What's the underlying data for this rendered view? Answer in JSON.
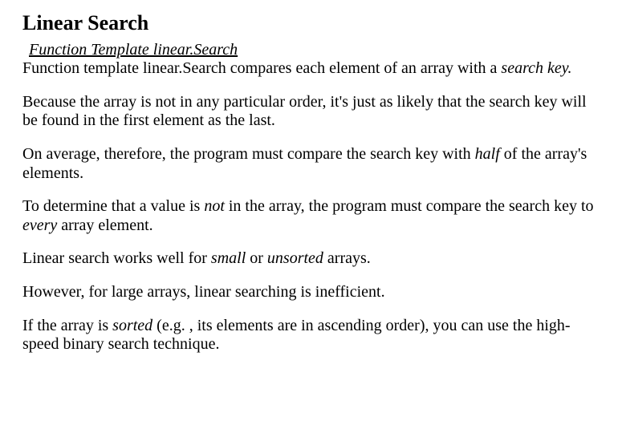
{
  "title": "Linear Search",
  "subheading": "Function Template linear.Search",
  "p1_a": "Function template linear.Search compares each element of an array with a ",
  "p1_b": "search key.",
  "p2": "Because the array is not in any particular order, it's just as likely that the search key will be found in the first element as the last.",
  "p3_a": "On average, therefore, the program must compare the search key with ",
  "p3_b": "half",
  "p3_c": " of the array's elements.",
  "p4_a": "To determine that a value is ",
  "p4_b": "not",
  "p4_c": " in the array, the program must compare the search key to ",
  "p4_d": "every",
  "p4_e": " array element.",
  "p5_a": "Linear search works well for ",
  "p5_b": "small",
  "p5_c": " or ",
  "p5_d": "unsorted",
  "p5_e": " arrays.",
  "p6": "However, for large arrays, linear searching is inefficient.",
  "p7_a": "If the array is ",
  "p7_b": "sorted",
  "p7_c": " (e.g. , its elements are in ascending order), you can use the high-speed binary search technique."
}
